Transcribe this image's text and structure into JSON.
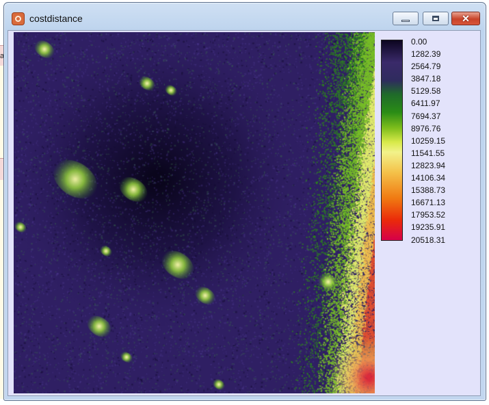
{
  "window": {
    "title": "costdistance",
    "icon": "app-icon",
    "controls": [
      "minimize-icon",
      "maximize-icon",
      "close-icon"
    ]
  },
  "background": {
    "partial_text": "a"
  },
  "legend": {
    "labels": [
      "0.00",
      "1282.39",
      "2564.79",
      "3847.18",
      "5129.58",
      "6411.97",
      "7694.37",
      "8976.76",
      "10259.15",
      "11541.55",
      "12823.94",
      "14106.34",
      "15388.73",
      "16671.13",
      "17953.52",
      "19235.91",
      "20518.31"
    ],
    "colors": [
      "#0c0520",
      "#3a2a6a",
      "#1f6a2a",
      "#2a8c16",
      "#7fbe1c",
      "#f2f28a",
      "#f07a12",
      "#ea2a0a",
      "#d6004a"
    ]
  },
  "map": {
    "base_color": "#2f1f63",
    "dark_color": "#0e0726",
    "vegetation_color": "#3d8a28"
  }
}
